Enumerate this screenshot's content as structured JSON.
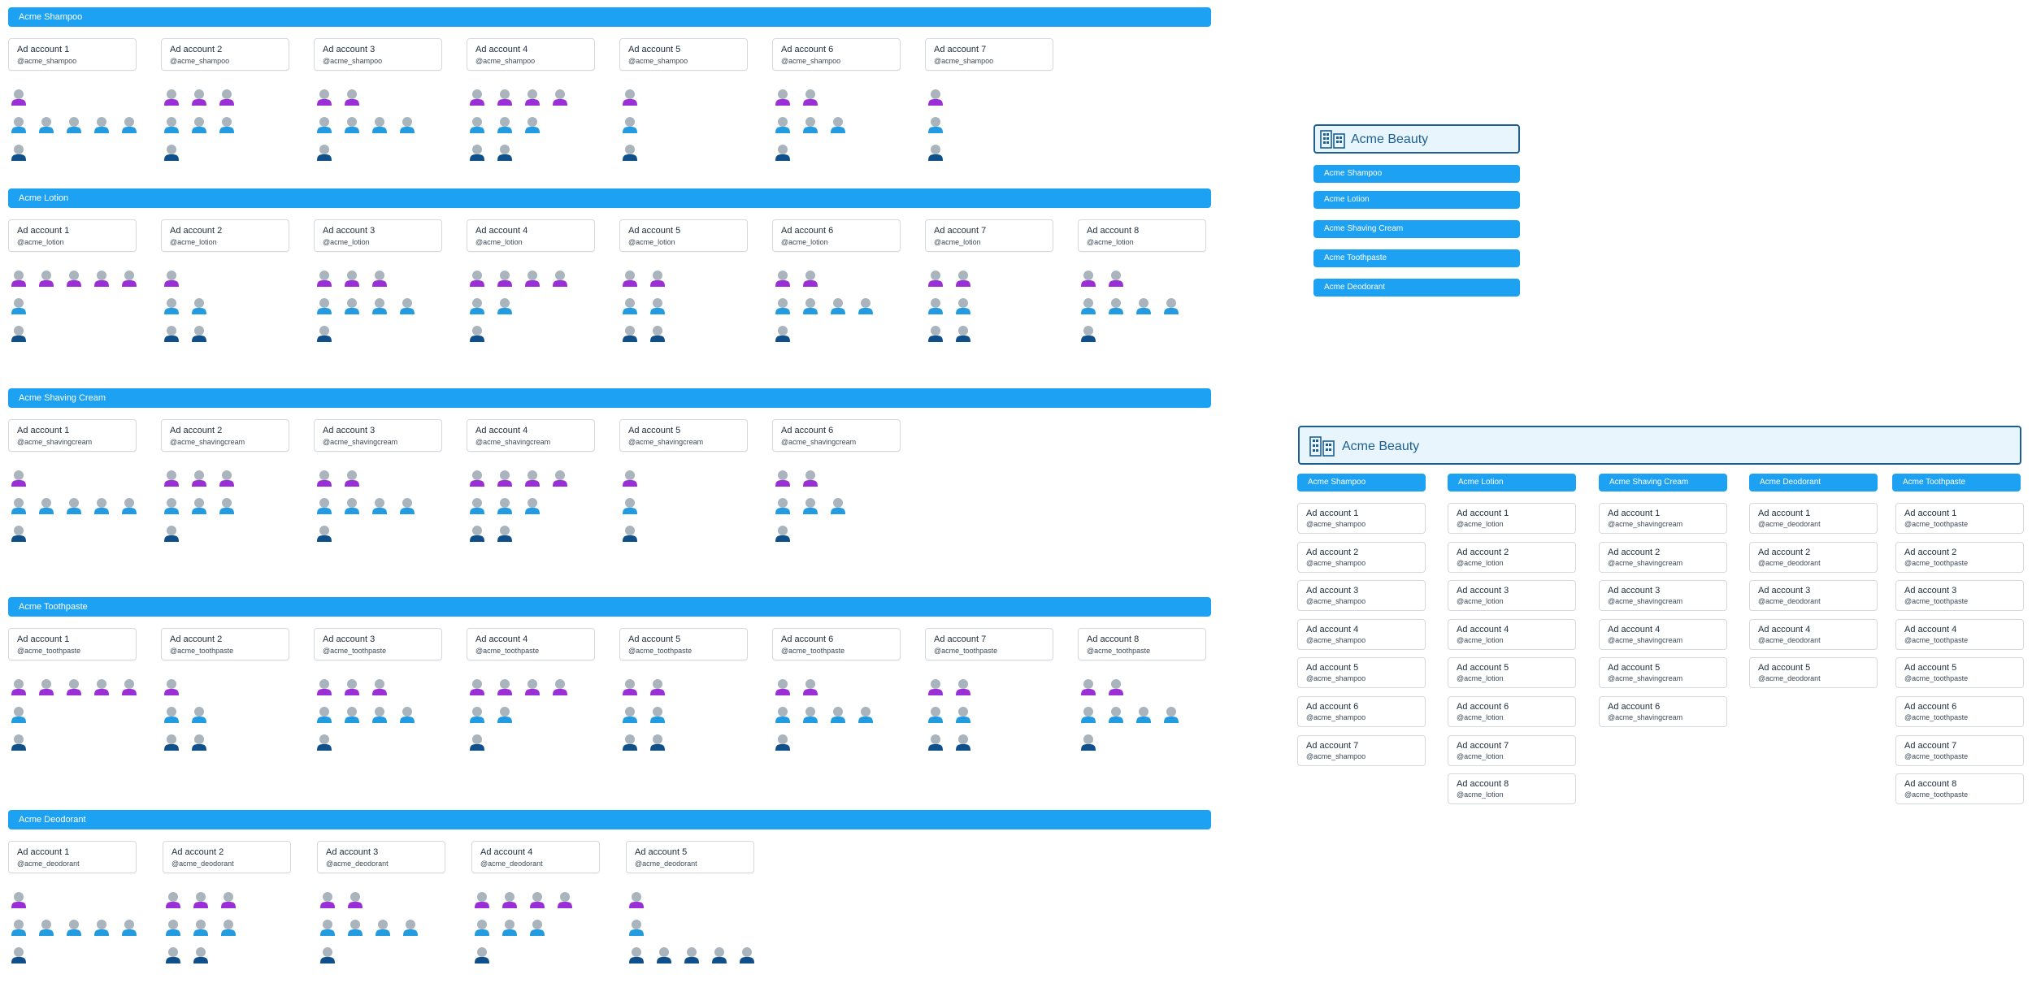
{
  "colors": {
    "bar": "#1da1f2",
    "purple": "#9b2fd6",
    "light_blue": "#239be0",
    "dark_blue": "#10508a",
    "head": "#a9b4bd",
    "accent_border": "#1e5f8f"
  },
  "icons": {
    "person": "person-icon",
    "building": "building-icon"
  },
  "brands": [
    {
      "name": "Acme Shampoo",
      "accounts": [
        {
          "name": "Ad account 1",
          "handle": "@acme_shampoo",
          "people": [
            1,
            5,
            1
          ]
        },
        {
          "name": "Ad account 2",
          "handle": "@acme_shampoo",
          "people": [
            3,
            3,
            1
          ]
        },
        {
          "name": "Ad account 3",
          "handle": "@acme_shampoo",
          "people": [
            2,
            4,
            1
          ]
        },
        {
          "name": "Ad account 4",
          "handle": "@acme_shampoo",
          "people": [
            4,
            3,
            2
          ]
        },
        {
          "name": "Ad account 5",
          "handle": "@acme_shampoo",
          "people": [
            1,
            1,
            1
          ]
        },
        {
          "name": "Ad account 6",
          "handle": "@acme_shampoo",
          "people": [
            2,
            3,
            1
          ]
        },
        {
          "name": "Ad account 7",
          "handle": "@acme_shampoo",
          "people": [
            1,
            1,
            1
          ]
        }
      ]
    },
    {
      "name": "Acme Lotion",
      "accounts": [
        {
          "name": "Ad account 1",
          "handle": "@acme_lotion",
          "people": [
            5,
            1,
            1
          ]
        },
        {
          "name": "Ad account 2",
          "handle": "@acme_lotion",
          "people": [
            1,
            2,
            2
          ]
        },
        {
          "name": "Ad account 3",
          "handle": "@acme_lotion",
          "people": [
            3,
            4,
            1
          ]
        },
        {
          "name": "Ad account 4",
          "handle": "@acme_lotion",
          "people": [
            4,
            2,
            1
          ]
        },
        {
          "name": "Ad account 5",
          "handle": "@acme_lotion",
          "people": [
            2,
            2,
            2
          ]
        },
        {
          "name": "Ad account 6",
          "handle": "@acme_lotion",
          "people": [
            2,
            4,
            1
          ]
        },
        {
          "name": "Ad account 7",
          "handle": "@acme_lotion",
          "people": [
            2,
            2,
            2
          ]
        },
        {
          "name": "Ad account 8",
          "handle": "@acme_lotion",
          "people": [
            2,
            4,
            1
          ]
        }
      ]
    },
    {
      "name": "Acme Shaving Cream",
      "accounts": [
        {
          "name": "Ad account 1",
          "handle": "@acme_shavingcream",
          "people": [
            1,
            5,
            1
          ]
        },
        {
          "name": "Ad account 2",
          "handle": "@acme_shavingcream",
          "people": [
            3,
            3,
            1
          ]
        },
        {
          "name": "Ad account 3",
          "handle": "@acme_shavingcream",
          "people": [
            2,
            4,
            1
          ]
        },
        {
          "name": "Ad account 4",
          "handle": "@acme_shavingcream",
          "people": [
            4,
            3,
            2
          ]
        },
        {
          "name": "Ad account 5",
          "handle": "@acme_shavingcream",
          "people": [
            1,
            1,
            1
          ]
        },
        {
          "name": "Ad account 6",
          "handle": "@acme_shavingcream",
          "people": [
            2,
            3,
            1
          ]
        }
      ]
    },
    {
      "name": "Acme Toothpaste",
      "accounts": [
        {
          "name": "Ad account 1",
          "handle": "@acme_toothpaste",
          "people": [
            5,
            1,
            1
          ]
        },
        {
          "name": "Ad account 2",
          "handle": "@acme_toothpaste",
          "people": [
            1,
            2,
            2
          ]
        },
        {
          "name": "Ad account 3",
          "handle": "@acme_toothpaste",
          "people": [
            3,
            4,
            1
          ]
        },
        {
          "name": "Ad account 4",
          "handle": "@acme_toothpaste",
          "people": [
            4,
            2,
            1
          ]
        },
        {
          "name": "Ad account 5",
          "handle": "@acme_toothpaste",
          "people": [
            2,
            2,
            2
          ]
        },
        {
          "name": "Ad account 6",
          "handle": "@acme_toothpaste",
          "people": [
            2,
            4,
            1
          ]
        },
        {
          "name": "Ad account 7",
          "handle": "@acme_toothpaste",
          "people": [
            2,
            2,
            2
          ]
        },
        {
          "name": "Ad account 8",
          "handle": "@acme_toothpaste",
          "people": [
            2,
            4,
            1
          ]
        }
      ]
    },
    {
      "name": "Acme Deodorant",
      "accounts": [
        {
          "name": "Ad account 1",
          "handle": "@acme_deodorant",
          "people": [
            1,
            5,
            1
          ]
        },
        {
          "name": "Ad account 2",
          "handle": "@acme_deodorant",
          "people": [
            3,
            3,
            2
          ]
        },
        {
          "name": "Ad account 3",
          "handle": "@acme_deodorant",
          "people": [
            2,
            4,
            1
          ]
        },
        {
          "name": "Ad account 4",
          "handle": "@acme_deodorant",
          "people": [
            4,
            3,
            1
          ]
        },
        {
          "name": "Ad account 5",
          "handle": "@acme_deodorant",
          "people": [
            1,
            1,
            5
          ]
        }
      ]
    }
  ],
  "summary_small": {
    "title": "Acme Beauty",
    "brands": [
      "Acme Shampoo",
      "Acme Lotion",
      "Acme Shaving Cream",
      "Acme Toothpaste",
      "Acme Deodorant"
    ]
  },
  "summary_large": {
    "title": "Acme Beauty",
    "columns": [
      {
        "name": "Acme Shampoo",
        "handle": "@acme_shampoo",
        "accounts": [
          "Ad account 1",
          "Ad account 2",
          "Ad account 3",
          "Ad account 4",
          "Ad account 5",
          "Ad account 6",
          "Ad account 7"
        ]
      },
      {
        "name": "Acme Lotion",
        "handle": "@acme_lotion",
        "accounts": [
          "Ad account 1",
          "Ad account 2",
          "Ad account 3",
          "Ad account 4",
          "Ad account 5",
          "Ad account 6",
          "Ad account 7",
          "Ad account 8"
        ]
      },
      {
        "name": "Acme Shaving Cream",
        "handle": "@acme_shavingcream",
        "accounts": [
          "Ad account 1",
          "Ad account 2",
          "Ad account 3",
          "Ad account 4",
          "Ad account 5",
          "Ad account 6"
        ]
      },
      {
        "name": "Acme Deodorant",
        "handle": "@acme_deodorant",
        "accounts": [
          "Ad account 1",
          "Ad account 2",
          "Ad account 3",
          "Ad account 4",
          "Ad account 5"
        ]
      },
      {
        "name": "Acme Toothpaste",
        "handle": "@acme_toothpaste",
        "accounts": [
          "Ad account 1",
          "Ad account 2",
          "Ad account 3",
          "Ad account 4",
          "Ad account 5",
          "Ad account 6",
          "Ad account 7",
          "Ad account 8"
        ]
      }
    ]
  }
}
